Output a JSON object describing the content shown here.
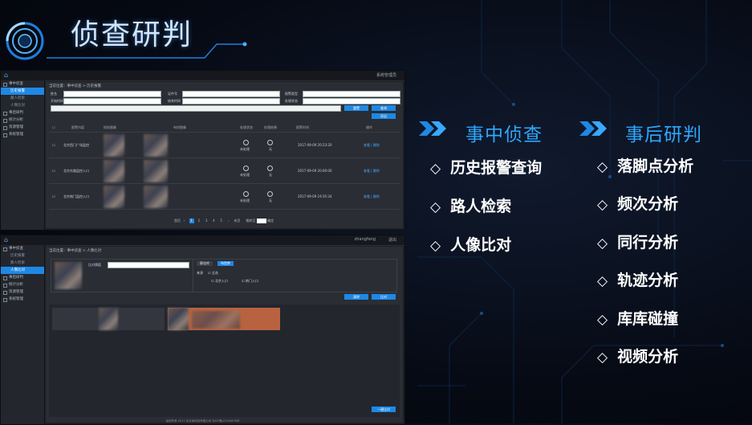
{
  "slide": {
    "title": "侦查研判"
  },
  "left_column": {
    "heading": "事中侦查",
    "items": [
      "历史报警查询",
      "路人检索",
      "人像比对"
    ]
  },
  "right_column": {
    "heading": "事后研判",
    "items": [
      "落脚点分析",
      "频次分析",
      "同行分析",
      "轨迹分析",
      "库库碰撞",
      "视频分析"
    ]
  },
  "screenshot_top": {
    "breadcrumb": "当前位置：事中侦查 > 历史报警",
    "sidebar": [
      "事中侦查",
      "历史报警",
      "路人检索",
      "人像比对",
      "事后研判",
      "统计分析",
      "资源管理",
      "系统管理"
    ],
    "filters": {
      "label1": "姓名",
      "ph1": "请输入姓名",
      "label2": "证件号",
      "ph2": "请输入证件号",
      "label3": "报警类型",
      "val3": "重点人员",
      "label4": "开始时间",
      "val4": "2017-09-02 00:00",
      "label5": "结束时间",
      "val5": "2017-09-08 12:00",
      "label6": "处理状态",
      "val6": "全部"
    },
    "search_btn": "查询",
    "reset_btn": "重置",
    "export_btn": "导出",
    "columns": [
      "",
      "报警内容",
      "抓拍图像",
      "",
      "布控图像",
      "处理状态",
      "处理结果",
      "报警时间",
      "操作"
    ],
    "rows": [
      {
        "name": "北京西门广场监控",
        "state": "未处理",
        "result": "无",
        "time": "2017-09-09 20:23:20",
        "ops": "查看 | 删除"
      },
      {
        "name": "北京东路监控入口",
        "state": "未处理",
        "result": "无",
        "time": "2017-09-09 20:00:00",
        "ops": "查看 | 删除"
      },
      {
        "name": "北京南门监控入口",
        "state": "未处理",
        "result": "无",
        "time": "2017-09-09 19:35:34",
        "ops": "查看 | 删除"
      }
    ],
    "pager": {
      "prev": "首页",
      "pages": [
        "1",
        "2",
        "3",
        "4",
        "5"
      ],
      "next": "末页",
      "goto": "跳转至",
      "go": "确定"
    },
    "user": "系统管理员"
  },
  "screenshot_bottom": {
    "breadcrumb": "当前位置：事中侦查 > 人像比对",
    "sidebar": [
      "事中侦查",
      "历史报警",
      "路人检索",
      "人像比对",
      "事后研判",
      "统计分析",
      "资源管理",
      "系统管理"
    ],
    "input_label": "比对阈值",
    "input_value": "80",
    "tabs": [
      "静态库",
      "布控库"
    ],
    "checkbox_label": "来源",
    "checkbox_all": "全选",
    "checkbox_a": "北京入口",
    "checkbox_b": "南门入口",
    "btn_clear": "清除",
    "btn_compare": "比对",
    "btn_bottom": "一键比对",
    "user": "zhangfang",
    "logout": "退出",
    "footer": "版权所有 2017 北京某科技有限公司  京ICP备12345678号"
  }
}
